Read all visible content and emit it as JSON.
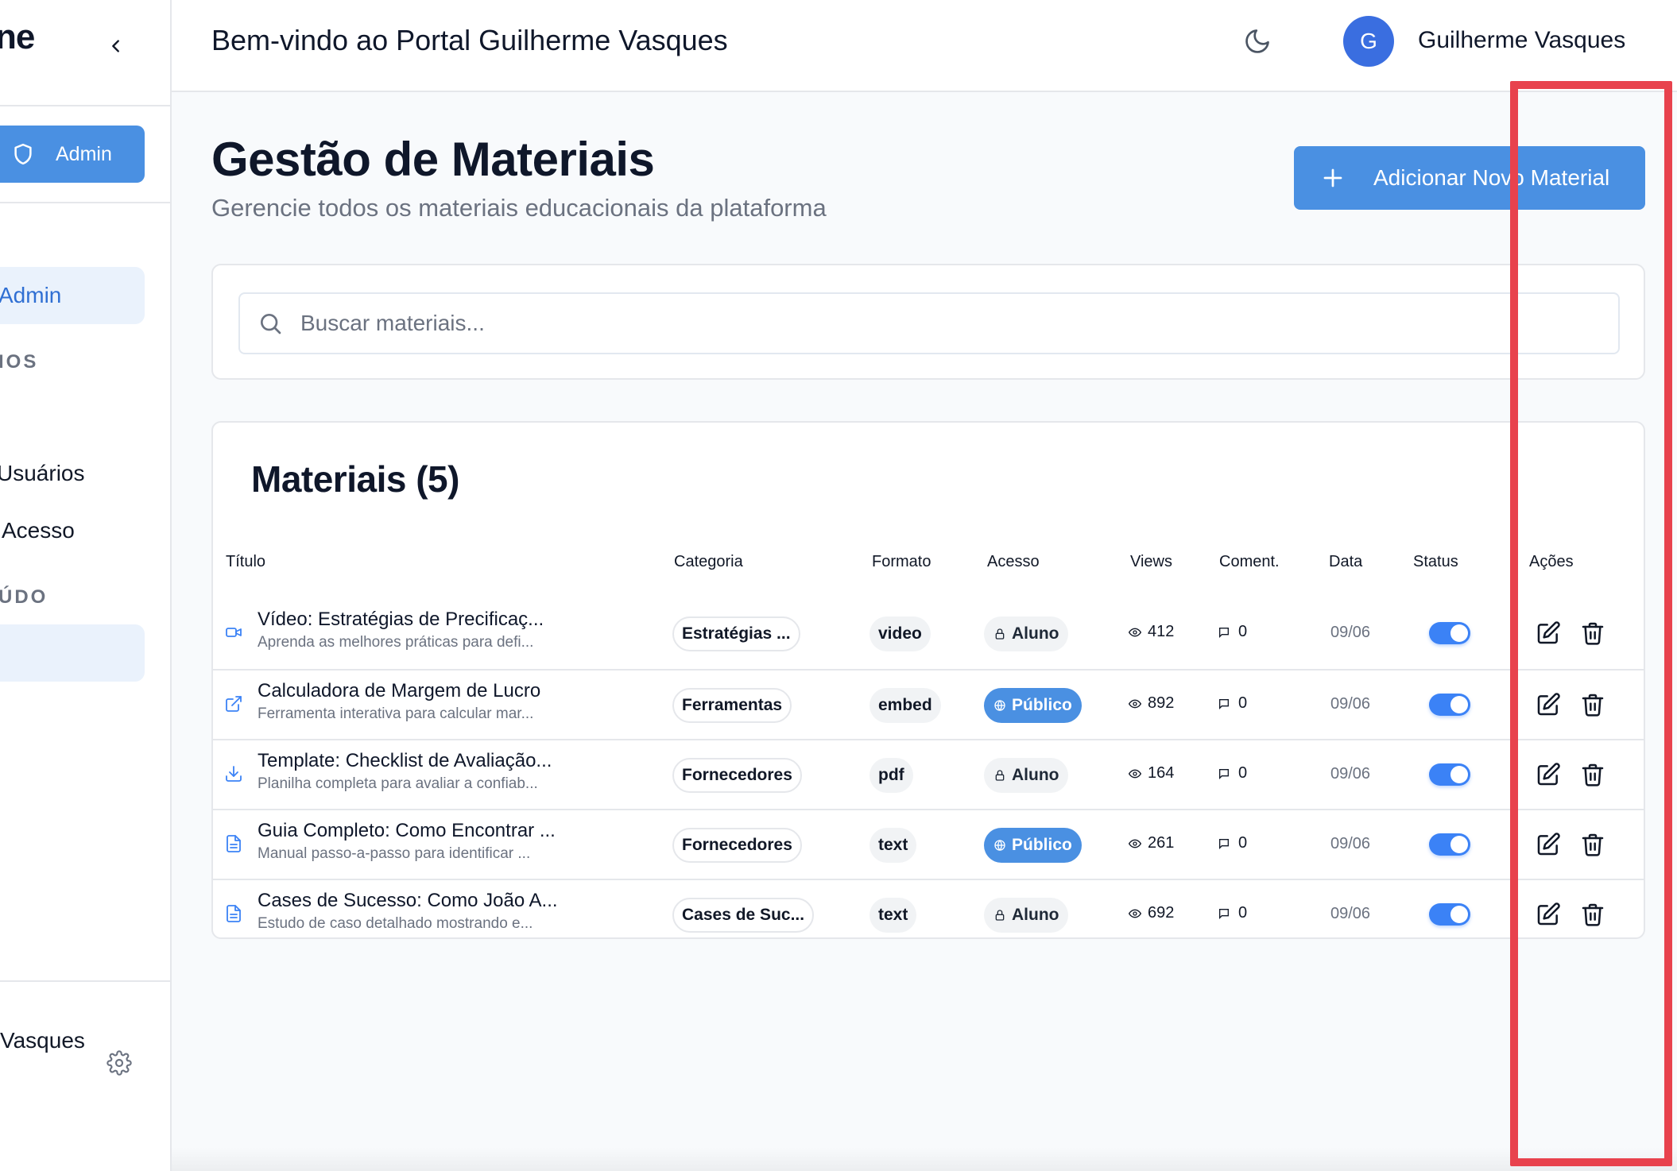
{
  "sidebar": {
    "logo_text": "ne",
    "role_button_label": "Admin",
    "active_item_label": "Admin",
    "section_1": "IOS",
    "item_users": "Usuários",
    "item_access": "Acesso",
    "section_2": "ÚDO",
    "footer_user": "Vasques"
  },
  "header": {
    "title": "Bem-vindo ao Portal Guilherme Vasques",
    "avatar_initial": "G",
    "user_name": "Guilherme Vasques"
  },
  "main": {
    "page_title": "Gestão de Materiais",
    "page_subtitle": "Gerencie todos os materiais educacionais da plataforma",
    "add_button_label": "Adicionar Novo Material",
    "search_placeholder": "Buscar materiais...",
    "table_title": "Materiais (5)",
    "columns": {
      "title": "Título",
      "category": "Categoria",
      "format": "Formato",
      "access": "Acesso",
      "views": "Views",
      "comments": "Coment.",
      "date": "Data",
      "status": "Status",
      "actions": "Ações"
    },
    "rows": [
      {
        "icon": "video-icon",
        "title": "Vídeo: Estratégias de Precificaç...",
        "desc": "Aprenda as melhores práticas para defi...",
        "category": "Estratégias ...",
        "format": "video",
        "access": "Aluno",
        "access_type": "aluno",
        "views": "412",
        "comments": "0",
        "date": "09/06",
        "status_on": true
      },
      {
        "icon": "external-link-icon",
        "title": "Calculadora de Margem de Lucro",
        "desc": "Ferramenta interativa para calcular mar...",
        "category": "Ferramentas",
        "format": "embed",
        "access": "Público",
        "access_type": "publico",
        "views": "892",
        "comments": "0",
        "date": "09/06",
        "status_on": true
      },
      {
        "icon": "download-icon",
        "title": "Template: Checklist de Avaliação...",
        "desc": "Planilha completa para avaliar a confiab...",
        "category": "Fornecedores",
        "format": "pdf",
        "access": "Aluno",
        "access_type": "aluno",
        "views": "164",
        "comments": "0",
        "date": "09/06",
        "status_on": true
      },
      {
        "icon": "document-icon",
        "title": "Guia Completo: Como Encontrar ...",
        "desc": "Manual passo-a-passo para identificar ...",
        "category": "Fornecedores",
        "format": "text",
        "access": "Público",
        "access_type": "publico",
        "views": "261",
        "comments": "0",
        "date": "09/06",
        "status_on": true
      },
      {
        "icon": "document-icon",
        "title": "Cases de Sucesso: Como João A...",
        "desc": "Estudo de caso detalhado mostrando e...",
        "category": "Cases de Suc...",
        "format": "text",
        "access": "Aluno",
        "access_type": "aluno",
        "views": "692",
        "comments": "0",
        "date": "09/06",
        "status_on": true
      }
    ]
  },
  "colors": {
    "accent": "#4a90e2",
    "toggle": "#3b82f6",
    "highlight": "#e8424d"
  }
}
